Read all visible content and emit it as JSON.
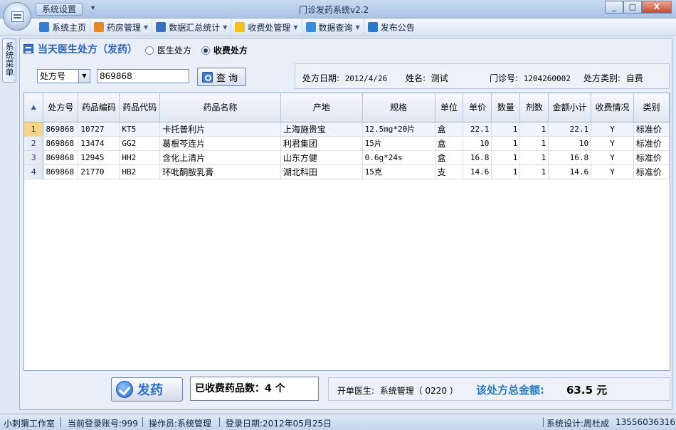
{
  "window": {
    "title": "门诊发药系统v2.2",
    "quick_menu": "系统设置",
    "buttons": [
      "_",
      "□",
      "X"
    ]
  },
  "menu": [
    {
      "label": "系统主页",
      "icon": "home-icon",
      "color": "#3b7bd1",
      "dropdown": false
    },
    {
      "label": "药房管理",
      "icon": "pharmacy-icon",
      "color": "#e6892b",
      "dropdown": true
    },
    {
      "label": "数据汇总统计",
      "icon": "chart-icon",
      "color": "#3a6fc0",
      "dropdown": true
    },
    {
      "label": "收费处管理",
      "icon": "star-icon",
      "color": "#f0c020",
      "dropdown": true
    },
    {
      "label": "数据查询",
      "icon": "query-icon",
      "color": "#3c8bd8",
      "dropdown": true
    },
    {
      "label": "发布公告",
      "icon": "notice-icon",
      "color": "#2c78c8",
      "dropdown": false
    }
  ],
  "side_tab": "系统菜单",
  "panel": {
    "title": "当天医生处方（发药）",
    "radio_doctor": "医生处方",
    "radio_charge": "收费处方",
    "search_field": "处方号",
    "search_value": "869868",
    "search_button": "查 询"
  },
  "info": {
    "date_label": "处方日期:",
    "date_value": "2012/4/26",
    "name_label": "姓名:",
    "name_value": "测试",
    "clinic_label": "门诊号:",
    "clinic_value": "1204260002",
    "type_label": "处方类别:",
    "type_value": "自费"
  },
  "table": {
    "columns": [
      "处方号",
      "药品编码",
      "药品代码",
      "药品名称",
      "产地",
      "规格",
      "单位",
      "单价",
      "数量",
      "剂数",
      "金额小计",
      "收费情况",
      "类别"
    ],
    "rows": [
      {
        "n": "1",
        "cells": [
          "869868",
          "10727",
          "KT5",
          "卡托普利片",
          "上海施贵宝",
          "12.5mg*20片",
          "盒",
          "22.1",
          "1",
          "1",
          "22.1",
          "Y",
          "标准价"
        ]
      },
      {
        "n": "2",
        "cells": [
          "869868",
          "13474",
          "GG2",
          "葛根芩连片",
          "利君集团",
          "15片",
          "盒",
          "10",
          "1",
          "1",
          "10",
          "Y",
          "标准价"
        ]
      },
      {
        "n": "3",
        "cells": [
          "869868",
          "12945",
          "HH2",
          "含化上清片",
          "山东方健",
          "0.6g*24s",
          "盒",
          "16.8",
          "1",
          "1",
          "16.8",
          "Y",
          "标准价"
        ]
      },
      {
        "n": "4",
        "cells": [
          "869868",
          "21770",
          "HB2",
          "环吡酮胺乳膏",
          "湖北科田",
          "15克",
          "支",
          "14.6",
          "1",
          "1",
          "14.6",
          "Y",
          "标准价"
        ]
      }
    ]
  },
  "bottom": {
    "dispense_button": "发药",
    "charged_count": "已收费药品数：4 个",
    "doctor_label": "开单医生:",
    "doctor_value": "系统管理（ 0220 ）",
    "total_label": "该处方总金额:",
    "total_value": "63.5 元"
  },
  "status": {
    "studio": "小刺猬工作室",
    "account": "当前登录账号:999",
    "operator": "操作员:系统管理",
    "login_date": "登录日期:2012年05月25日",
    "designer": "系统设计:周杜成",
    "phone": "13556036316"
  }
}
